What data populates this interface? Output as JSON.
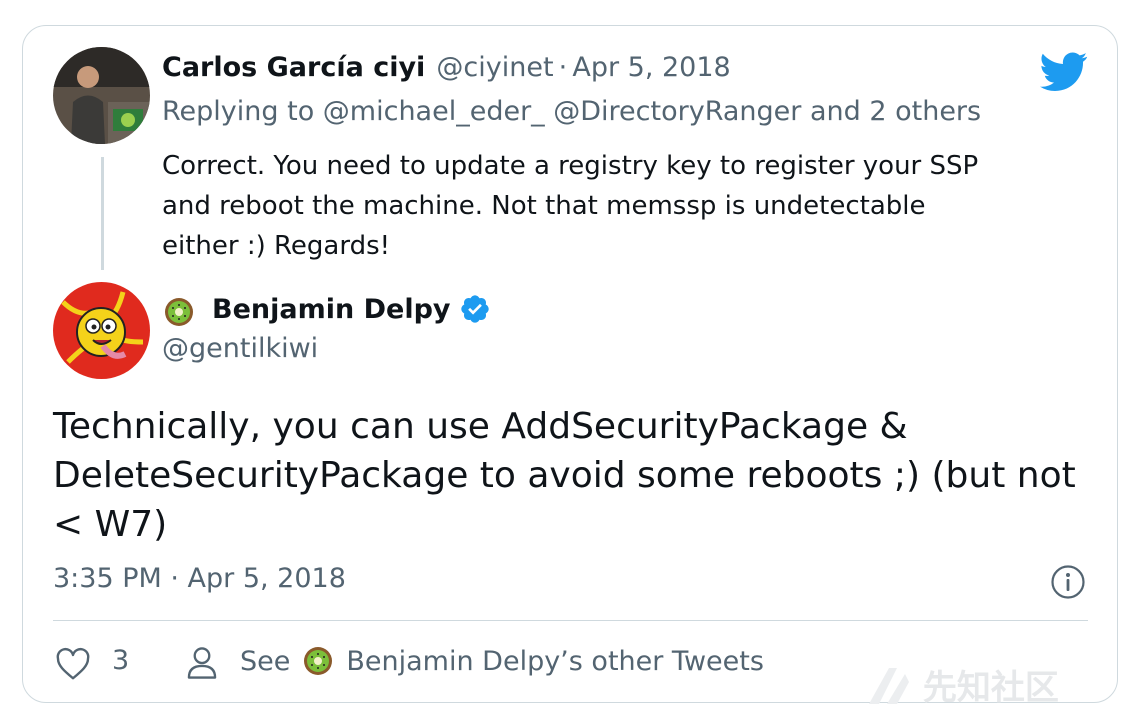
{
  "reply": {
    "author_name": "Carlos García ciyi",
    "handle": "@ciyinet",
    "separator": "·",
    "date": "Apr 5, 2018",
    "replying_to": "Replying to @michael_eder_ @DirectoryRanger and 2 others",
    "text_line1": "Correct. You need to update a registry key to register your SSP",
    "text_line2": "and reboot the machine. Not that memssp is undetectable",
    "text_line3": "either :) Regards!"
  },
  "tweet": {
    "author_name": "Benjamin Delpy",
    "handle": "@gentilkiwi",
    "text_line1": "Technically, you can use AddSecurityPackage &",
    "text_line2": "DeleteSecurityPackage to avoid some reboots ;) (but not",
    "text_line3": "< W7)",
    "timestamp": "3:35 PM · Apr 5, 2018"
  },
  "actions": {
    "like_count": "3",
    "see_label": "See",
    "other_tweets_label": "Benjamin Delpy’s other Tweets"
  },
  "watermark": "先知社区",
  "colors": {
    "twitter_blue": "#1d9bf0",
    "muted": "#536471",
    "border": "#cfd9de"
  },
  "icons": {
    "brand": "twitter-bird-icon",
    "verified": "verified-badge-icon",
    "kiwi": "kiwi-emoji-icon",
    "info": "info-icon",
    "like": "heart-icon",
    "profile": "person-icon"
  }
}
